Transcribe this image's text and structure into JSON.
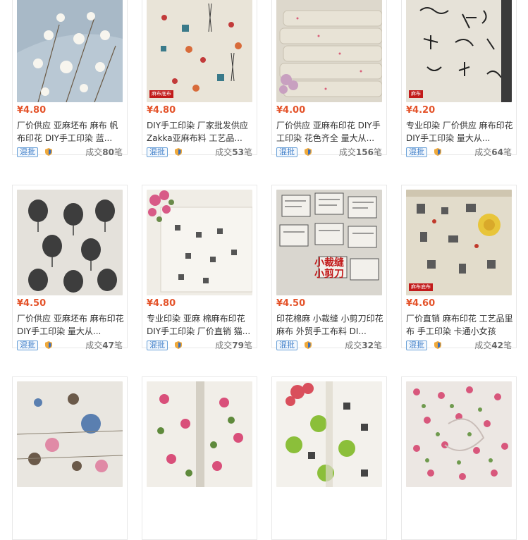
{
  "products": [
    {
      "price": "¥4.80",
      "title": "厂价供应 亚麻坯布 麻布 帆布印花 DIY手工印染 蓝...",
      "badge": "混批",
      "deals_prefix": "成交",
      "deals_count": "80",
      "deals_suffix": "笔",
      "thumb_tag": ""
    },
    {
      "price": "¥4.80",
      "title": "DIY手工印染 厂家批发供应 Zakka亚麻布料 工艺品...",
      "badge": "混批",
      "deals_prefix": "成交",
      "deals_count": "53",
      "deals_suffix": "笔",
      "thumb_tag": "麻布底布"
    },
    {
      "price": "¥4.00",
      "title": "厂价供应 亚麻布印花 DIY手工印染 花色齐全 量大从...",
      "badge": "混批",
      "deals_prefix": "成交",
      "deals_count": "156",
      "deals_suffix": "笔",
      "thumb_tag": ""
    },
    {
      "price": "¥4.20",
      "title": "专业印染 厂价供应 麻布印花 DIY手工印染 量大从...",
      "badge": "混批",
      "deals_prefix": "成交",
      "deals_count": "64",
      "deals_suffix": "笔",
      "thumb_tag": "麻布"
    },
    {
      "price": "¥4.50",
      "title": "厂价供应 亚麻坯布 麻布印花 DIY手工印染 量大从...",
      "badge": "混批",
      "deals_prefix": "成交",
      "deals_count": "47",
      "deals_suffix": "笔",
      "thumb_tag": ""
    },
    {
      "price": "¥4.80",
      "title": "专业印染 亚麻 棉麻布印花 DIY手工印染 厂价直销 猫...",
      "badge": "混批",
      "deals_prefix": "成交",
      "deals_count": "79",
      "deals_suffix": "笔",
      "thumb_tag": ""
    },
    {
      "price": "¥4.50",
      "title": "印花棉麻 小裁缝 小剪刀印花麻布 外贸手工布料 DI...",
      "badge": "混批",
      "deals_prefix": "成交",
      "deals_count": "32",
      "deals_suffix": "笔",
      "thumb_tag": "",
      "thumb_art": [
        "小裁缝",
        "小剪刀"
      ]
    },
    {
      "price": "¥4.60",
      "title": "厂价直销 麻布印花 工艺品里布 手工印染 卡通小女孩",
      "badge": "混批",
      "deals_prefix": "成交",
      "deals_count": "42",
      "deals_suffix": "笔",
      "thumb_tag": "麻布底布"
    },
    {
      "thumb_tag": ""
    },
    {
      "thumb_tag": ""
    },
    {
      "thumb_tag": ""
    },
    {
      "thumb_tag": ""
    }
  ],
  "colors": {
    "price": "#e4532a",
    "badge": "#3a7bc8",
    "tag": "#c21a1a"
  }
}
